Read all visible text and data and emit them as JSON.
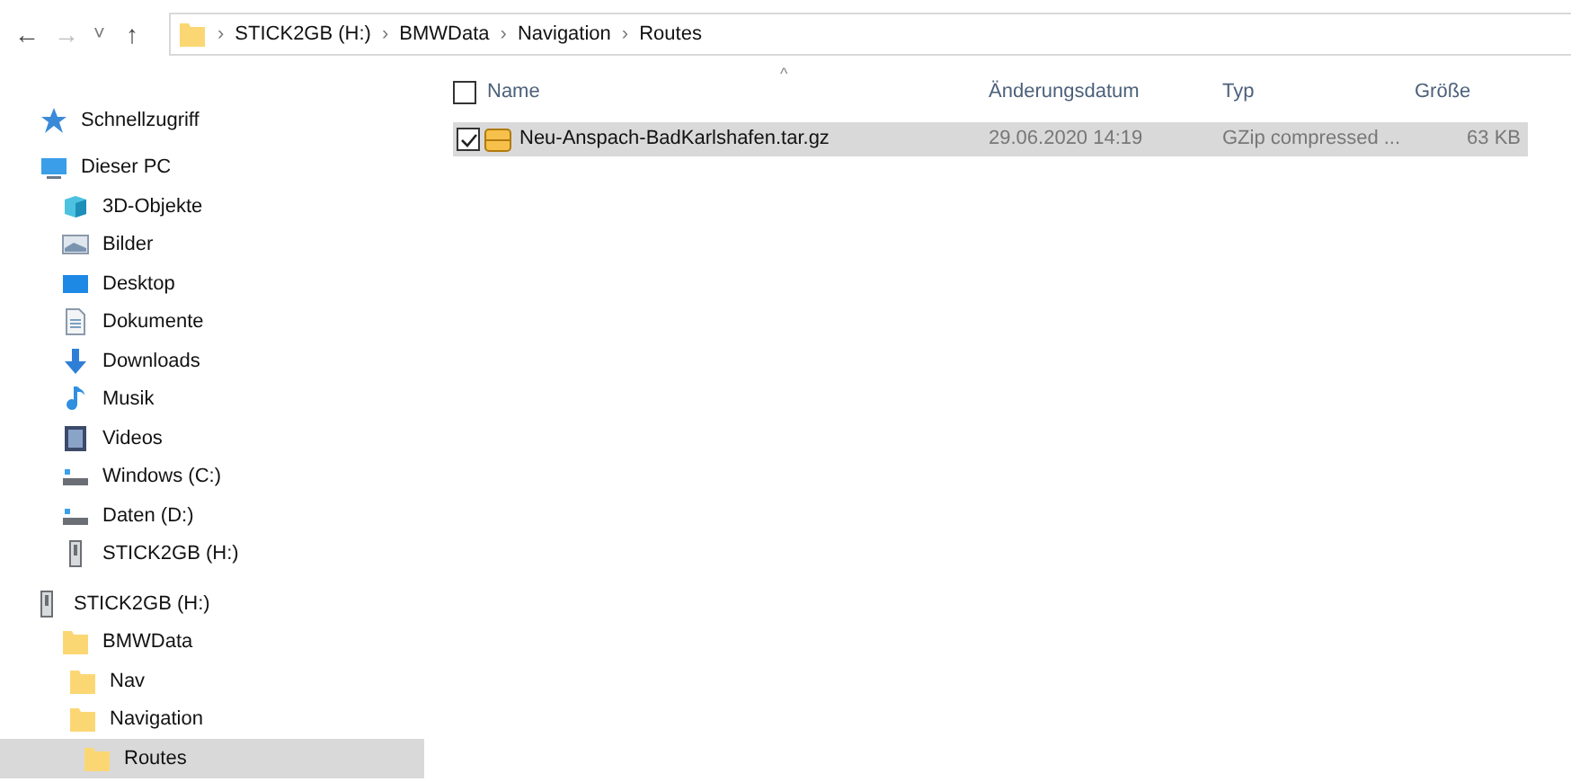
{
  "toolbar": {
    "back": "←",
    "forward": "→",
    "recent": "˅",
    "up": "↑",
    "breadcrumb": [
      "STICK2GB (H:)",
      "BMWData",
      "Navigation",
      "Routes"
    ],
    "separator": "›"
  },
  "sidebar": {
    "items": [
      {
        "label": "Schnellzugriff",
        "kind": "star",
        "selected": false
      },
      {
        "label": "Dieser PC",
        "kind": "pc",
        "selected": false,
        "children": [
          {
            "label": "3D-Objekte",
            "kind": "cube",
            "selected": false
          },
          {
            "label": "Bilder",
            "kind": "pictures",
            "selected": false
          },
          {
            "label": "Desktop",
            "kind": "desktop",
            "selected": false
          },
          {
            "label": "Dokumente",
            "kind": "document",
            "selected": false
          },
          {
            "label": "Downloads",
            "kind": "download",
            "selected": false
          },
          {
            "label": "Musik",
            "kind": "music",
            "selected": false
          },
          {
            "label": "Videos",
            "kind": "video",
            "selected": false
          },
          {
            "label": "Windows (C:)",
            "kind": "drive",
            "selected": false
          },
          {
            "label": "Daten (D:)",
            "kind": "drive",
            "selected": false
          },
          {
            "label": "STICK2GB (H:)",
            "kind": "usb",
            "selected": false
          }
        ]
      },
      {
        "label": "STICK2GB (H:)",
        "kind": "usb",
        "selected": false,
        "children": [
          {
            "label": "BMWData",
            "kind": "folder",
            "selected": false,
            "children": [
              {
                "label": "Nav",
                "kind": "folder",
                "selected": false
              },
              {
                "label": "Navigation",
                "kind": "folder",
                "selected": false,
                "children": [
                  {
                    "label": "Routes",
                    "kind": "folder",
                    "selected": true
                  }
                ]
              }
            ]
          }
        ]
      }
    ]
  },
  "table": {
    "sort_arrow": "^",
    "columns": [
      "Name",
      "Änderungsdatum",
      "Typ",
      "Größe"
    ],
    "header_checked": false,
    "rows": [
      {
        "name": "Neu-Anspach-BadKarlshafen.tar.gz",
        "date": "29.06.2020 14:19",
        "type": "GZip compressed ...",
        "size": "63 KB",
        "selected": true,
        "checked": true
      }
    ]
  }
}
